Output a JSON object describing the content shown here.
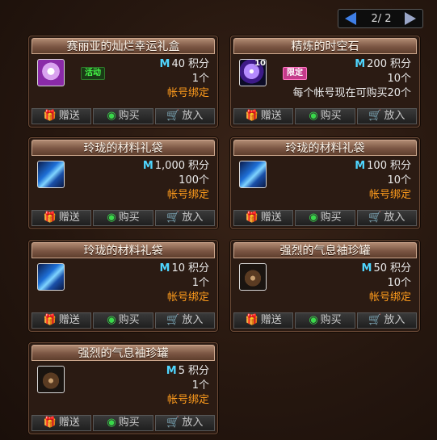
{
  "pagination": {
    "label": "2/ 2"
  },
  "buttons": {
    "gift": "赠送",
    "buy": "购买",
    "cart": "放入"
  },
  "items": [
    {
      "title": "赛丽亚的灿烂幸运礼盒",
      "icon": "gift-box-icon",
      "tag": "活动",
      "price": "40",
      "unit": "积分",
      "count": "1个",
      "bind": "帐号绑定",
      "limit": ""
    },
    {
      "title": "精炼的时空石",
      "icon": "time-stone-orb-icon",
      "badge": "10",
      "tag": "限定",
      "price": "200",
      "unit": "积分",
      "count": "10个",
      "bind": "",
      "limit": "每个帐号现在可购买20个"
    },
    {
      "title": "玲珑的材料礼袋",
      "icon": "material-bag-icon",
      "tag": "",
      "price": "1,000",
      "unit": "积分",
      "count": "100个",
      "bind": "帐号绑定",
      "limit": ""
    },
    {
      "title": "玲珑的材料礼袋",
      "icon": "material-bag-icon",
      "tag": "",
      "price": "100",
      "unit": "积分",
      "count": "10个",
      "bind": "帐号绑定",
      "limit": ""
    },
    {
      "title": "玲珑的材料礼袋",
      "icon": "material-bag-icon",
      "tag": "",
      "price": "10",
      "unit": "积分",
      "count": "1个",
      "bind": "帐号绑定",
      "limit": ""
    },
    {
      "title": "强烈的气息袖珍罐",
      "icon": "breath-jar-icon",
      "tag": "",
      "price": "50",
      "unit": "积分",
      "count": "10个",
      "bind": "帐号绑定",
      "limit": ""
    },
    {
      "title": "强烈的气息袖珍罐",
      "icon": "breath-jar-icon",
      "tag": "",
      "price": "5",
      "unit": "积分",
      "count": "1个",
      "bind": "帐号绑定",
      "limit": ""
    }
  ],
  "currency_symbol": "M"
}
